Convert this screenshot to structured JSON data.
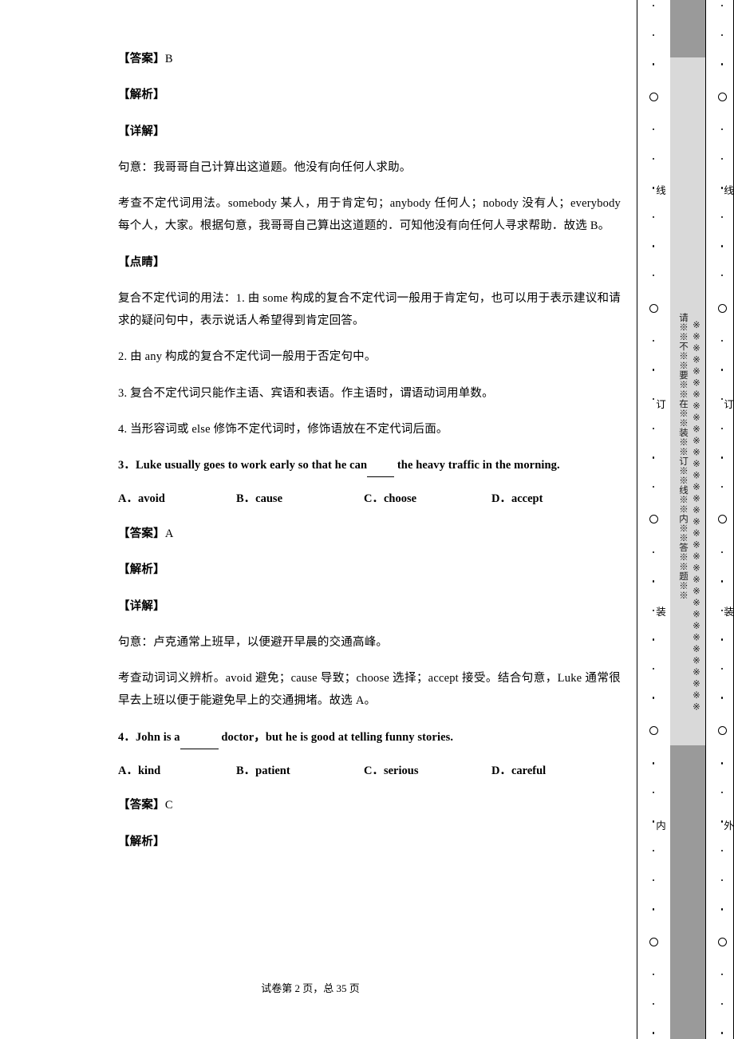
{
  "document": {
    "footer": "试卷第 2 页，总 35 页"
  },
  "blocks": [
    {
      "kind": "para",
      "tag": "【答案】",
      "text": "B"
    },
    {
      "kind": "para",
      "tag": "【解析】",
      "text": ""
    },
    {
      "kind": "para",
      "tag": "【详解】",
      "text": ""
    },
    {
      "kind": "para",
      "tag": "",
      "text": "句意：我哥哥自己计算出这道题。他没有向任何人求助。"
    },
    {
      "kind": "para",
      "tag": "",
      "text": "考查不定代词用法。somebody 某人，用于肯定句；anybody 任何人；nobody 没有人；everybody 每个人，大家。根据句意，我哥哥自己算出这道题的．可知他没有向任何人寻求帮助．故选 B。"
    },
    {
      "kind": "para",
      "tag": "【点睛】",
      "text": ""
    },
    {
      "kind": "para",
      "tag": "",
      "text": "复合不定代词的用法：1. 由 some 构成的复合不定代词一般用于肯定句，也可以用于表示建议和请求的疑问句中，表示说话人希望得到肯定回答。"
    },
    {
      "kind": "para",
      "tag": "",
      "text": "2. 由 any 构成的复合不定代词一般用于否定句中。"
    },
    {
      "kind": "para",
      "tag": "",
      "text": "3. 复合不定代词只能作主语、宾语和表语。作主语时，谓语动词用单数。"
    },
    {
      "kind": "para",
      "tag": "",
      "text": "4. 当形容词或 else 修饰不定代词时，修饰语放在不定代词后面。"
    }
  ],
  "questions": [
    {
      "number": "3．",
      "stem_before": "Luke usually goes to work early so that he can",
      "stem_after": "the heavy traffic in the morning.",
      "options": [
        "A．avoid",
        "B．cause",
        "C．choose",
        "D．accept"
      ],
      "explain": [
        {
          "tag": "【答案】",
          "text": "A"
        },
        {
          "tag": "【解析】",
          "text": ""
        },
        {
          "tag": "【详解】",
          "text": ""
        },
        {
          "tag": "",
          "text": "句意：卢克通常上班早，以便避开早晨的交通高峰。"
        },
        {
          "tag": "",
          "text": "考查动词词义辨析。avoid 避免；cause 导致；choose 选择；accept 接受。结合句意，Luke 通常很早去上班以便于能避免早上的交通拥堵。故选 A。"
        }
      ]
    },
    {
      "number": "4．",
      "stem_before": "John is a",
      "stem_after": "doctor，but he is good at telling funny stories.",
      "options": [
        "A．kind",
        "B．patient",
        "C．serious",
        "D．careful"
      ],
      "explain": [
        {
          "tag": "【答案】",
          "text": "C"
        },
        {
          "tag": "【解析】",
          "text": ""
        }
      ]
    }
  ],
  "margin": {
    "seal_line_inner": "线",
    "seal_line_outer": "线",
    "seal_bind_inner": "订",
    "seal_bind_outer": "订",
    "seal_pack_inner": "装",
    "seal_pack_outer": "装",
    "label_inner": "内",
    "label_outer": "外",
    "band_text": "※※※※※※※※※※※※※※※※※※※※※※※※※※※※※※※※※※",
    "notice_text": "请※※不※※要※※在※※装※※订※※线※※内※※答※※题※※"
  }
}
